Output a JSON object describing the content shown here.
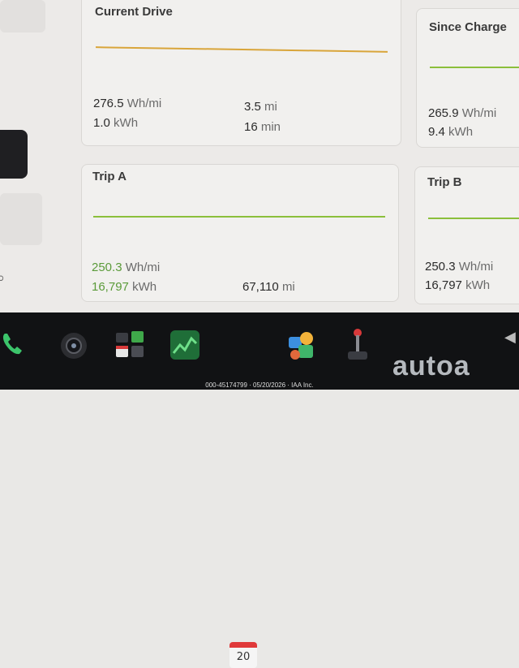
{
  "cards": {
    "current_drive": {
      "title": "Current Drive",
      "avg_value": "276.5",
      "avg_unit": "Wh/mi",
      "energy_value": "1.0",
      "energy_unit": "kWh",
      "distance_value": "3.5",
      "distance_unit": "mi",
      "time_value": "16",
      "time_unit": "min"
    },
    "since_charge": {
      "title": "Since Charge",
      "avg_value": "265.9",
      "avg_unit": "Wh/mi",
      "energy_value": "9.4",
      "energy_unit": "kWh"
    },
    "trip_a": {
      "title": "Trip A",
      "avg_value": "250.3",
      "avg_unit": "Wh/mi",
      "energy_value": "16,797",
      "energy_unit": "kWh",
      "distance_value": "67,110",
      "distance_unit": "mi"
    },
    "trip_b": {
      "title": "Trip B",
      "avg_value": "250.3",
      "avg_unit": "Wh/mi",
      "energy_value": "16,797",
      "energy_unit": "kWh"
    }
  },
  "taskbar": {
    "icons": [
      "phone-icon",
      "camera-icon",
      "apps-icon",
      "energy-icon",
      "calendar-icon",
      "toybox-icon",
      "joystick-icon",
      "volume-icon"
    ],
    "calendar_day": "20"
  },
  "overlay": {
    "watermark": "autoa",
    "footer_id": "000-45174799 · 05/20/2026 · IAA Inc."
  },
  "colors": {
    "green_line": "#8bbf3b",
    "orange_line": "#d9a53a",
    "efficiency_green": "#5b9b3a"
  }
}
